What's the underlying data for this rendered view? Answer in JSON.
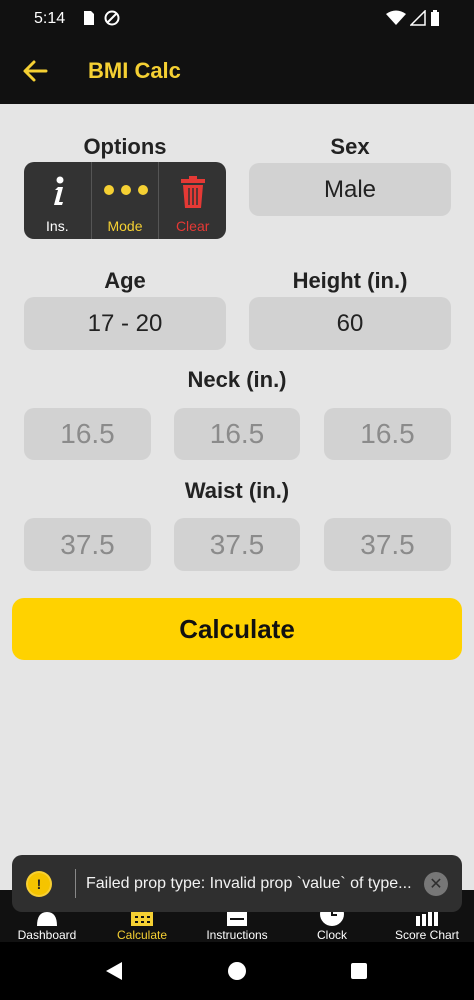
{
  "status_bar": {
    "time": "5:14"
  },
  "app_bar": {
    "title": "BMI Calc"
  },
  "options": {
    "title": "Options",
    "buttons": [
      {
        "label": "Ins.",
        "color": "#ffffff"
      },
      {
        "label": "Mode",
        "color": "#f5d033"
      },
      {
        "label": "Clear",
        "color": "#e53935"
      }
    ]
  },
  "sex": {
    "label": "Sex",
    "value": "Male"
  },
  "age": {
    "label": "Age",
    "value": "17 - 20"
  },
  "height": {
    "label": "Height (in.)",
    "value": "60"
  },
  "neck": {
    "label": "Neck (in.)",
    "values": [
      "16.5",
      "16.5",
      "16.5"
    ]
  },
  "waist": {
    "label": "Waist (in.)",
    "values": [
      "37.5",
      "37.5",
      "37.5"
    ]
  },
  "calculate_button": {
    "label": "Calculate"
  },
  "toast": {
    "message": "Failed prop type: Invalid prop `value` of type..."
  },
  "tabs": [
    {
      "label": "Dashboard",
      "icon": "dashboard-icon",
      "active": false
    },
    {
      "label": "Calculate",
      "icon": "calculator-icon",
      "active": true
    },
    {
      "label": "Instructions",
      "icon": "instructions-icon",
      "active": false
    },
    {
      "label": "Clock",
      "icon": "clock-icon",
      "active": false
    },
    {
      "label": "Score Chart",
      "icon": "bar-chart-icon",
      "active": false
    }
  ],
  "colors": {
    "accent": "#f5d033",
    "button": "#ffd200",
    "danger": "#e53935"
  }
}
